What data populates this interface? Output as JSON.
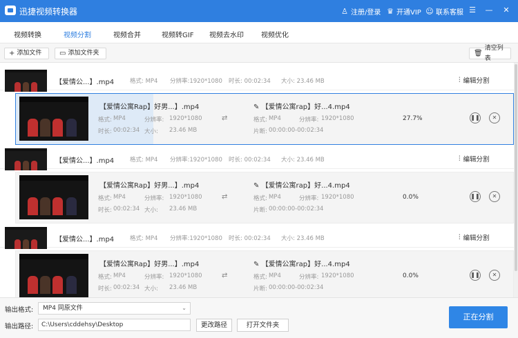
{
  "app": {
    "title": "迅捷视频转换器",
    "register_label": "注册/登录",
    "vip_label": "开通VIP",
    "service_label": "联系客服",
    "menu_glyph": "☰",
    "minimize_glyph": "—",
    "close_glyph": "✕"
  },
  "tabs": [
    {
      "label": "视频转换"
    },
    {
      "label": "视频分割"
    },
    {
      "label": "视频合并"
    },
    {
      "label": "视频转GIF"
    },
    {
      "label": "视频去水印"
    },
    {
      "label": "视频优化"
    }
  ],
  "toolbar": {
    "add_file_label": "添加文件",
    "add_folder_label": "添加文件夹",
    "clear_list_label": "清空列表"
  },
  "groups": [
    {
      "parent": {
        "name": "【爱情公...】.mp4",
        "format": "格式: MP4",
        "resolution": "分辨率:1920*1080",
        "duration": "时长: 00:02:34",
        "size": "大小: 23.46 MB",
        "edit_label": "编辑分割"
      },
      "child": {
        "name": "【爱情公寓Rap】好男...】.mp4",
        "format_label": "格式:",
        "format_value": "MP4",
        "resolution_label": "分辨率:",
        "resolution_value": "1920*1080",
        "duration_label": "时长:",
        "duration_value": "00:02:34",
        "size_label": "大小:",
        "size_value": "23.46 MB",
        "out_name": "【爱情公寓rap】好...4.mp4",
        "out_format_label": "格式:",
        "out_format_value": "MP4",
        "out_resolution_label": "分辨率:",
        "out_resolution_value": "1920*1080",
        "segment_label": "片断:",
        "segment_value": "00:00:00-00:02:34",
        "progress": "27.7%",
        "progress_fraction": 0.277
      }
    },
    {
      "parent": {
        "name": "【爱情公...】.mp4",
        "format": "格式: MP4",
        "resolution": "分辨率:1920*1080",
        "duration": "时长: 00:02:34",
        "size": "大小: 23.46 MB",
        "edit_label": "编辑分割"
      },
      "child": {
        "name": "【爱情公寓Rap】好男...】.mp4",
        "format_label": "格式:",
        "format_value": "MP4",
        "resolution_label": "分辨率:",
        "resolution_value": "1920*1080",
        "duration_label": "时长:",
        "duration_value": "00:02:34",
        "size_label": "大小:",
        "size_value": "23.46 MB",
        "out_name": "【爱情公寓rap】好...4.mp4",
        "out_format_label": "格式:",
        "out_format_value": "MP4",
        "out_resolution_label": "分辨率:",
        "out_resolution_value": "1920*1080",
        "segment_label": "片断:",
        "segment_value": "00:00:00-00:02:34",
        "progress": "0.0%",
        "progress_fraction": 0.0
      }
    },
    {
      "parent": {
        "name": "【爱情公...】.mp4",
        "format": "格式: MP4",
        "resolution": "分辨率:1920*1080",
        "duration": "时长: 00:02:34",
        "size": "大小: 23.46 MB",
        "edit_label": "编辑分割"
      },
      "child": {
        "name": "【爱情公寓Rap】好男...】.mp4",
        "format_label": "格式:",
        "format_value": "MP4",
        "resolution_label": "分辨率:",
        "resolution_value": "1920*1080",
        "duration_label": "时长:",
        "duration_value": "00:02:34",
        "size_label": "大小:",
        "size_value": "23.46 MB",
        "out_name": "【爱情公寓rap】好...4.mp4",
        "out_format_label": "格式:",
        "out_format_value": "MP4",
        "out_resolution_label": "分辨率:",
        "out_resolution_value": "1920*1080",
        "segment_label": "片断:",
        "segment_value": "00:00:00-00:02:34",
        "progress": "0.0%",
        "progress_fraction": 0.0
      }
    }
  ],
  "bottom": {
    "format_label": "输出格式:",
    "format_value": "MP4  同原文件",
    "path_label": "输出路径:",
    "path_value": "C:\\Users\\cddehsy\\Desktop",
    "change_path_label": "更改路径",
    "open_folder_label": "打开文件夹",
    "split_button_label": "正在分割"
  },
  "colors": {
    "accent": "#2f7fe0",
    "split_button": "#2f86e6"
  }
}
